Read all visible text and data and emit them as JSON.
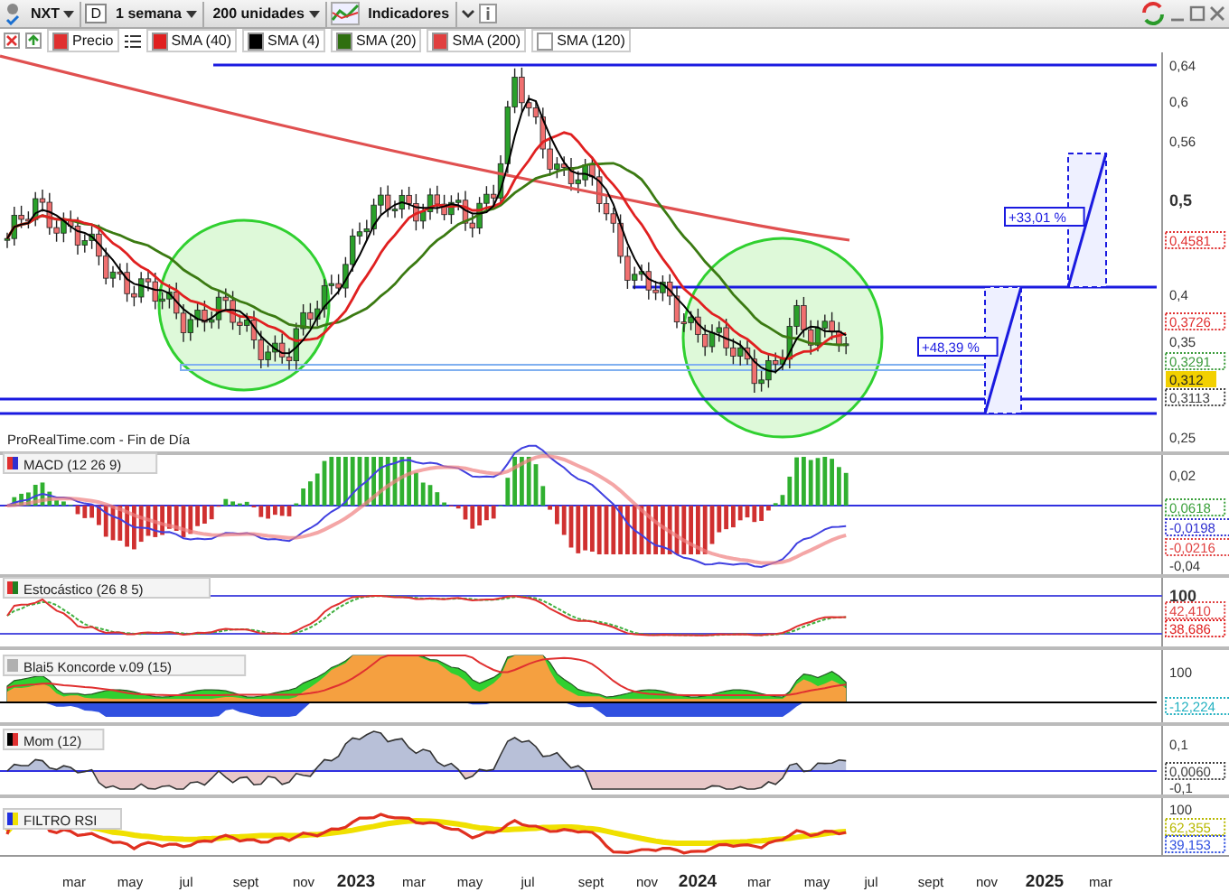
{
  "toolbar": {
    "symbol": "NXT",
    "period_button": "D",
    "timeframe": "1 semana",
    "units": "200 unidades",
    "indicators": "Indicadores"
  },
  "legend": [
    {
      "label": "Precio",
      "color": "#e03030"
    },
    {
      "label": "SMA (40)",
      "color": "#e02020"
    },
    {
      "label": "SMA (4)",
      "color": "#000000"
    },
    {
      "label": "SMA (20)",
      "color": "#2f6f10"
    },
    {
      "label": "SMA (200)",
      "color": "#e04040"
    },
    {
      "label": "SMA (120)",
      "color": "#ffffff"
    }
  ],
  "price_chart": {
    "source": "ProRealTime.com - Fin de Día",
    "y_ticks": [
      "0,64",
      "0,6",
      "0,56",
      "0,5",
      "0,4",
      "0,35",
      "0,25"
    ],
    "markers": [
      {
        "text": "0,4581",
        "color": "#e03030",
        "filled": false
      },
      {
        "text": "0,3726",
        "color": "#e03030",
        "filled": false
      },
      {
        "text": "0,3291",
        "color": "#3a9a3a",
        "filled": false
      },
      {
        "text": "0,312",
        "color": "#f2d000",
        "filled": true
      },
      {
        "text": "0,3113",
        "color": "#404040",
        "filled": false
      }
    ],
    "annotations": [
      "+48,39 %",
      "+33,01 %"
    ]
  },
  "panels": [
    {
      "kind": "macd",
      "title": "MACD (12 26 9)",
      "y_ticks": [
        "0,02",
        "-0,04"
      ],
      "markers": [
        {
          "text": "0,0618",
          "color": "#3aa03a"
        },
        {
          "text": "-0,0198",
          "color": "#3030d0"
        },
        {
          "text": "-0,0216",
          "color": "#e04040"
        }
      ]
    },
    {
      "kind": "stochastic",
      "title": "Estocástico (26 8 5)",
      "y_ticks": [
        "100"
      ],
      "markers": [
        {
          "text": "42,410",
          "color": "#e04040"
        },
        {
          "text": "38,686",
          "color": "#e02020"
        }
      ]
    },
    {
      "kind": "koncorde",
      "title": "Blai5 Koncorde v.09 (15)",
      "y_ticks": [
        "100"
      ],
      "markers": [
        {
          "text": "-12,224",
          "color": "#20b0c0"
        }
      ]
    },
    {
      "kind": "momentum",
      "title": "Mom (12)",
      "y_ticks": [
        "0,1",
        "-0,1"
      ],
      "markers": [
        {
          "text": "0,0060",
          "color": "#404040"
        }
      ]
    },
    {
      "kind": "rsi",
      "title": "FILTRO RSI",
      "y_ticks": [
        "100"
      ],
      "markers": [
        {
          "text": "62,355",
          "color": "#b8b800"
        },
        {
          "text": "39,153",
          "color": "#3050e0"
        }
      ]
    }
  ],
  "x_axis": [
    {
      "label": "mar",
      "kind": "month"
    },
    {
      "label": "may",
      "kind": "month"
    },
    {
      "label": "jul",
      "kind": "month"
    },
    {
      "label": "sept",
      "kind": "month"
    },
    {
      "label": "nov",
      "kind": "month"
    },
    {
      "label": "2023",
      "kind": "year"
    },
    {
      "label": "mar",
      "kind": "month"
    },
    {
      "label": "may",
      "kind": "month"
    },
    {
      "label": "jul",
      "kind": "month"
    },
    {
      "label": "sept",
      "kind": "month"
    },
    {
      "label": "nov",
      "kind": "month"
    },
    {
      "label": "2024",
      "kind": "year"
    },
    {
      "label": "mar",
      "kind": "month"
    },
    {
      "label": "may",
      "kind": "month"
    },
    {
      "label": "jul",
      "kind": "month"
    },
    {
      "label": "sept",
      "kind": "month"
    },
    {
      "label": "nov",
      "kind": "month"
    },
    {
      "label": "2025",
      "kind": "year"
    },
    {
      "label": "mar",
      "kind": "month"
    }
  ]
}
